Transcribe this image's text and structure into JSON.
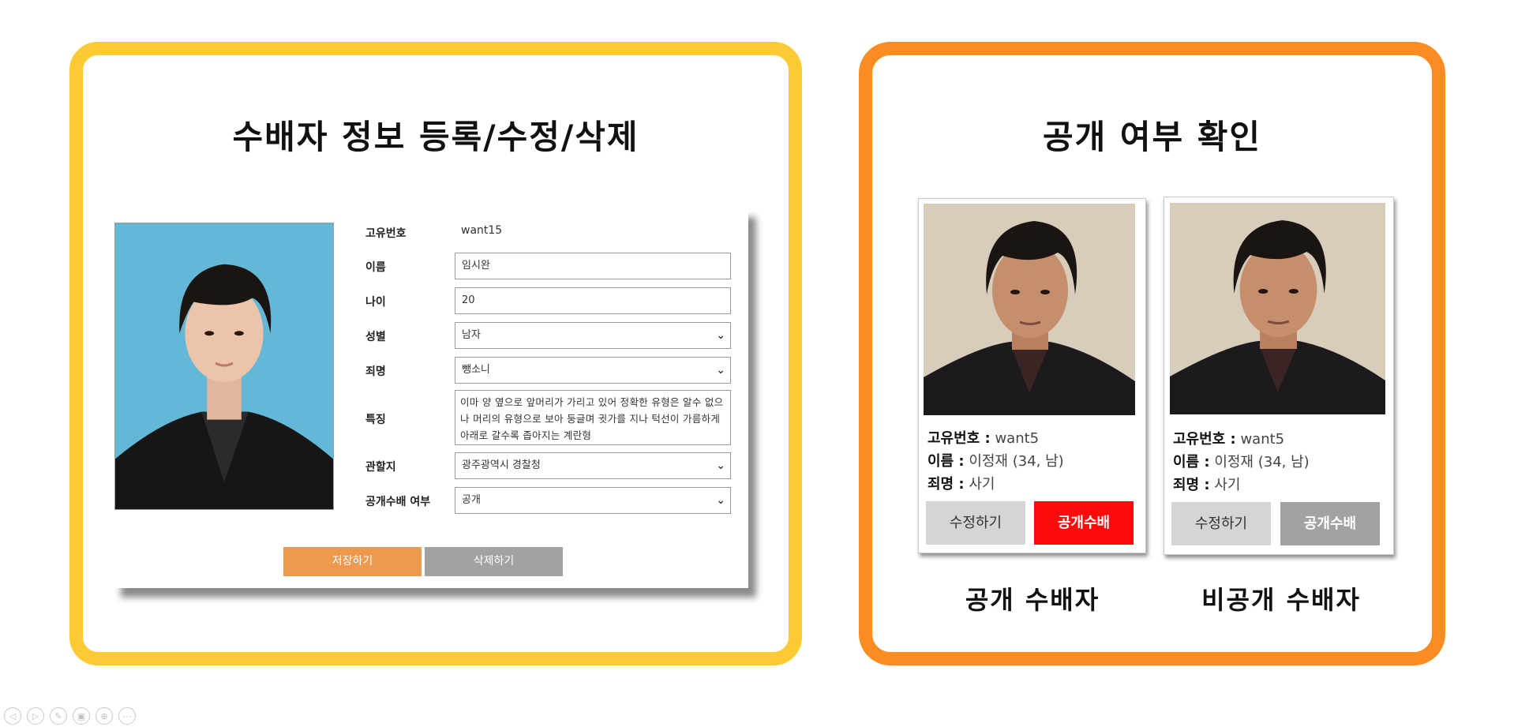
{
  "left_panel": {
    "title": "수배자 정보 등록/수정/삭제",
    "form": {
      "id_label": "고유번호",
      "id_value": "want15",
      "name_label": "이름",
      "name_value": "임시완",
      "age_label": "나이",
      "age_value": "20",
      "gender_label": "성별",
      "gender_value": "남자",
      "crime_label": "죄명",
      "crime_value": "뺑소니",
      "feature_label": "특징",
      "feature_value": "이마 양 옆으로 앞머리가 가리고 있어 정확한 유형은 알수 없으나 머리의 유형으로 보아 둥글며 귓가를 지나 턱선이 가름하게 아래로 갈수록 좁아지는 계란형",
      "jurisdiction_label": "관할지",
      "jurisdiction_value": "광주광역시 경찰청",
      "public_label": "공개수배 여부",
      "public_value": "공개",
      "save_label": "저장하기",
      "delete_label": "삭제하기"
    }
  },
  "right_panel": {
    "title": "공개 여부 확인",
    "cards": [
      {
        "id_label": "고유번호 :",
        "id_value": " want5",
        "name_label": "이름 :",
        "name_value": " 이정재 (34, 남)",
        "crime_label": "죄명 :",
        "crime_value": " 사기",
        "edit_label": "수정하기",
        "wanted_label": "공개수배",
        "caption": "공개 수배자"
      },
      {
        "id_label": "고유번호 :",
        "id_value": " want5",
        "name_label": "이름 :",
        "name_value": " 이정재 (34, 남)",
        "crime_label": "죄명 :",
        "crime_value": " 사기",
        "edit_label": "수정하기",
        "wanted_label": "공개수배",
        "caption": "비공개 수배자"
      }
    ]
  },
  "colors": {
    "left_border": "#fccb33",
    "right_border": "#fb8c22",
    "save_button": "#ed9a4e",
    "gray_button": "#a3a1a1",
    "public_wanted_button": "#ff0a0a"
  },
  "slideshow_nav": [
    "prev-icon",
    "next-icon",
    "pen-icon",
    "slides-icon",
    "zoom-icon",
    "more-icon"
  ]
}
